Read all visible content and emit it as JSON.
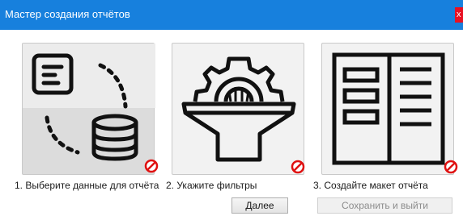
{
  "window": {
    "title": "Мастер создания отчётов",
    "close_label": "x"
  },
  "steps": [
    {
      "label": "1. Выберите данные для отчёта",
      "icon": "data-source-icon",
      "status": "not-available"
    },
    {
      "label": "2. Укажите фильтры",
      "icon": "filter-icon",
      "status": "not-available"
    },
    {
      "label": "3. Создайте макет отчёта",
      "icon": "report-layout-icon",
      "status": "not-available"
    }
  ],
  "buttons": {
    "next_label": "Далее",
    "save_label": "Сохранить и выйти"
  },
  "colors": {
    "titlebar": "#1780dd",
    "close": "#e81123",
    "badge": "#e01010"
  }
}
